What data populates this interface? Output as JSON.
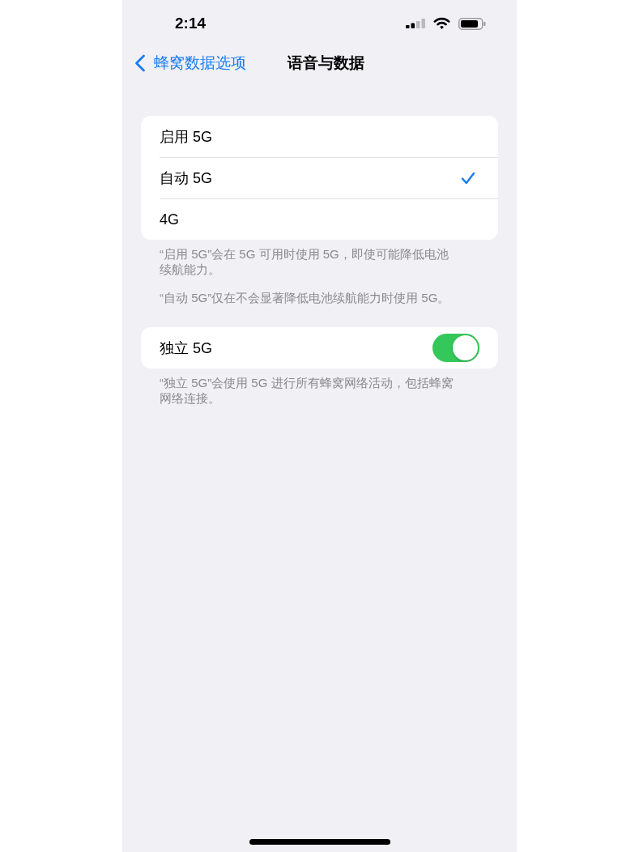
{
  "status_bar": {
    "time": "2:14"
  },
  "nav_bar": {
    "back_label": "蜂窝数据选项",
    "title": "语音与数据"
  },
  "voice_and_data": {
    "options": [
      {
        "label": "启用 5G",
        "selected": false
      },
      {
        "label": "自动 5G",
        "selected": true
      },
      {
        "label": "4G",
        "selected": false
      }
    ],
    "footnotes": [
      "“启用 5G”会在 5G 可用时使用 5G，即使可能降低电池续航能力。",
      "“自动 5G”仅在不会显著降低电池续航能力时使用 5G。"
    ]
  },
  "standalone_5g": {
    "label": "独立 5G",
    "on": true,
    "footnotes": [
      "“独立 5G”会使用 5G 进行所有蜂窝网络活动，包括蜂窝网络连接。"
    ]
  }
}
